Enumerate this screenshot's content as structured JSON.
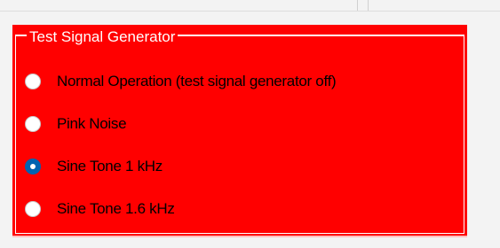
{
  "groupbox": {
    "title": "Test Signal Generator",
    "background_color": "#ff0000",
    "options": [
      {
        "label": "Normal Operation (test signal generator off)",
        "selected": false
      },
      {
        "label": "Pink Noise",
        "selected": false
      },
      {
        "label": "Sine Tone 1 kHz",
        "selected": true
      },
      {
        "label": "Sine Tone 1.6 kHz",
        "selected": false
      }
    ]
  },
  "colors": {
    "radio_selected": "#0063b1",
    "window_background": "#f3f3f3"
  }
}
